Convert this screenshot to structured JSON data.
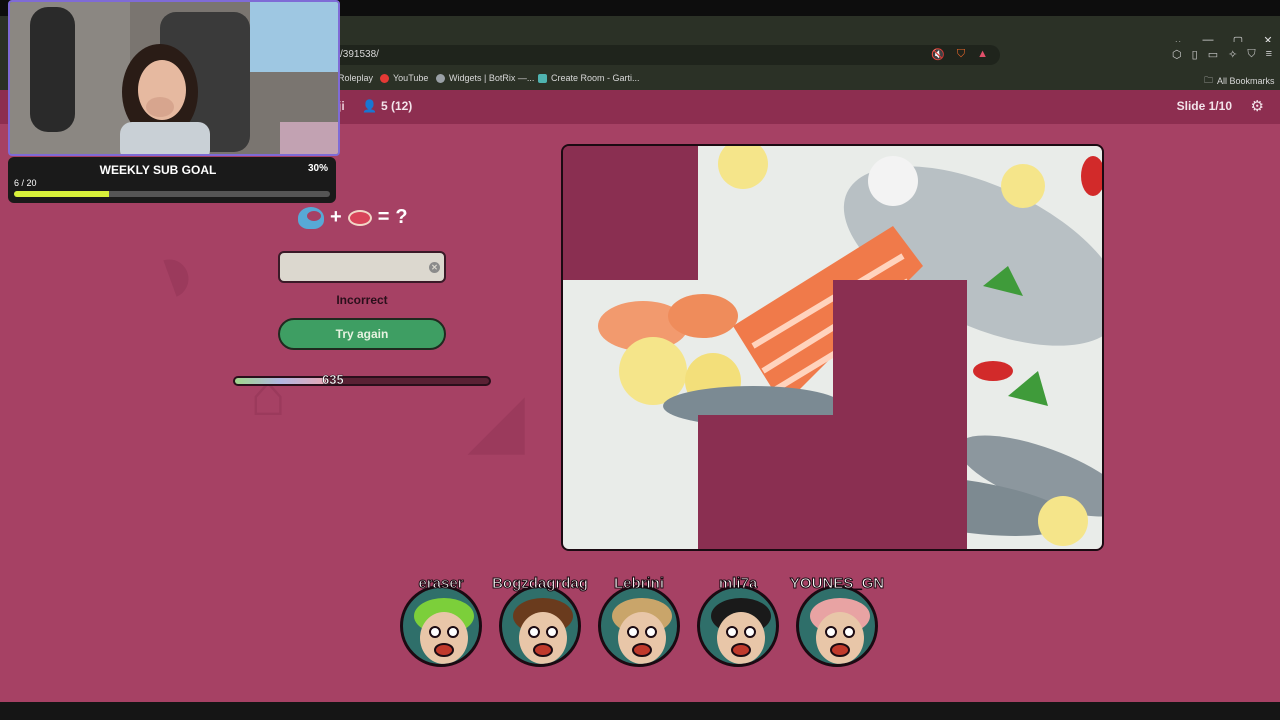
{
  "browser": {
    "url": "/391538/",
    "bookmarks": [
      {
        "label": "Roleplay",
        "color": "#888888"
      },
      {
        "label": "YouTube",
        "color": "#e53935"
      },
      {
        "label": "Widgets | BotRix —...",
        "color": "#9aa0a6"
      },
      {
        "label": "Create Room - Garti...",
        "color": "#4fb3b0"
      }
    ],
    "all_bookmarks_label": "All Bookmarks",
    "window_controls": [
      "⌄",
      "—",
      "▢",
      "✕"
    ]
  },
  "header": {
    "name_fragment": "ji",
    "players": "5 (12)",
    "slide": "Slide 1/10"
  },
  "puzzle": {
    "equation_plus": "+",
    "equation_equals": "=",
    "equation_question": "?",
    "input_value": "",
    "status": "Incorrect",
    "button": "Try again",
    "timer_value": "635",
    "timer_fraction": 0.36,
    "tiles_revealed": [
      1,
      2,
      3,
      4,
      5,
      7,
      8,
      11
    ]
  },
  "players": [
    {
      "name": "eraser",
      "color": "#2f6f6a",
      "hair": "#7ccf3a"
    },
    {
      "name": "Bogzdagrdag",
      "color": "#2f6f6a",
      "hair": "#6a3b1d"
    },
    {
      "name": "Lebrini",
      "color": "#2f6f6a",
      "hair": "#c9a56a"
    },
    {
      "name": "mli7a",
      "color": "#2f6f6a",
      "hair": "#1a1a1a"
    },
    {
      "name": "YOUNES_GN",
      "color": "#2f6f6a",
      "hair": "#e8a3a3"
    }
  ],
  "overlay": {
    "sub_goal_title": "WEEKLY SUB GOAL",
    "sub_goal_percent": "30%",
    "sub_goal_count": "6 / 20",
    "sub_goal_fraction": 0.3
  }
}
